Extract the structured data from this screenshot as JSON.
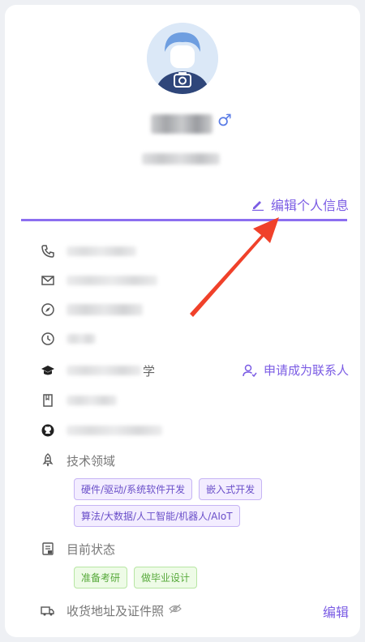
{
  "profile": {
    "gender_symbol": "♂",
    "edit_profile_label": "编辑个人信息"
  },
  "info": {
    "school_tail": "学",
    "apply_contact_label": "申请成为联系人"
  },
  "tech": {
    "label": "技术领域",
    "tags": [
      "硬件/驱动/系统软件开发",
      "嵌入式开发",
      "算法/大数据/人工智能/机器人/AIoT"
    ]
  },
  "status": {
    "label": "目前状态",
    "tags": [
      "准备考研",
      "做毕业设计"
    ]
  },
  "address": {
    "label": "收货地址及证件照",
    "edit_label": "编辑"
  },
  "colors": {
    "accent": "#7b5ce4",
    "divider": "#8c6ef0",
    "arrow": "#f0412a"
  }
}
